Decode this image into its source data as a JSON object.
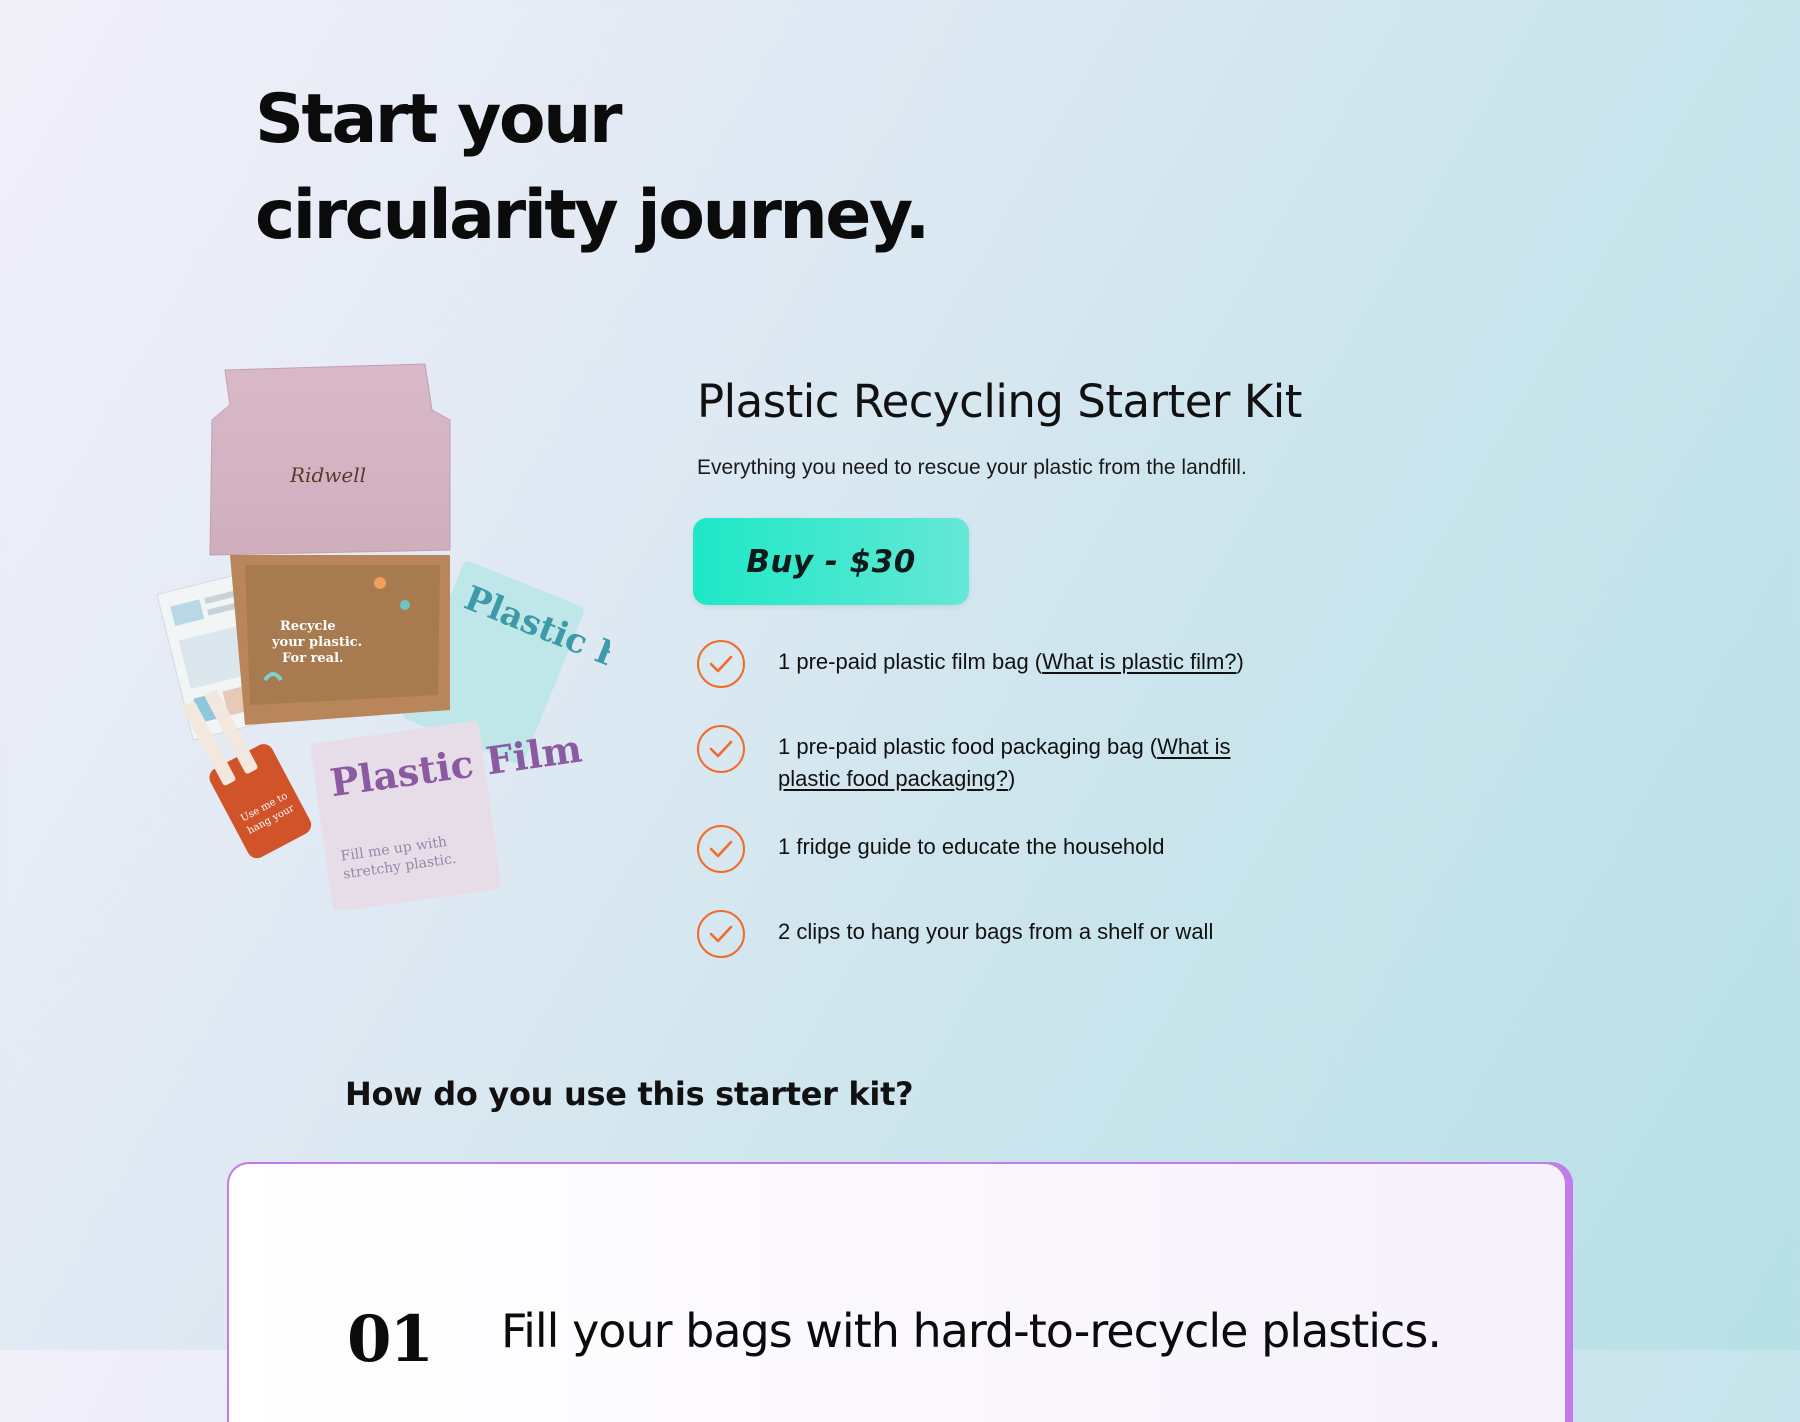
{
  "hero": {
    "line1": "Start your",
    "line2": "circularity journey."
  },
  "product": {
    "image_alt": "Ridwell plastic recycling starter kit box with bags and guide",
    "box_brand": "Ridwell",
    "box_inner_text": "Recycle your plastic. For real.",
    "bag1_text": "Plastic Food Packaging",
    "bag2_title": "Plastic Film",
    "bag2_sub": "Fill me up with flimsy stretchy plastic.",
    "tag_text": "Use me to hang your Ridwell bags!",
    "title": "Plastic Recycling Starter Kit",
    "subtitle": "Everything you need to rescue your plastic from the landfill.",
    "buy_label": "Buy - $30"
  },
  "features": [
    {
      "before": "1 pre-paid plastic film bag (",
      "link": "What is plastic film?",
      "after": ")"
    },
    {
      "before": "1 pre-paid plastic food packaging bag (",
      "link": "What is plastic food packaging?",
      "after": ")"
    },
    {
      "text": "1 fridge guide to educate the household"
    },
    {
      "text": "2 clips to hang your bags from a shelf or wall"
    }
  ],
  "how": {
    "title": "How do you use this starter kit?",
    "step_number": "01",
    "step_text": "Fill your bags with hard-to-recycle plastics."
  },
  "colors": {
    "accent_teal": "#1ee8c6",
    "check_orange": "#f26b2b",
    "card_border": "#c27be8"
  }
}
